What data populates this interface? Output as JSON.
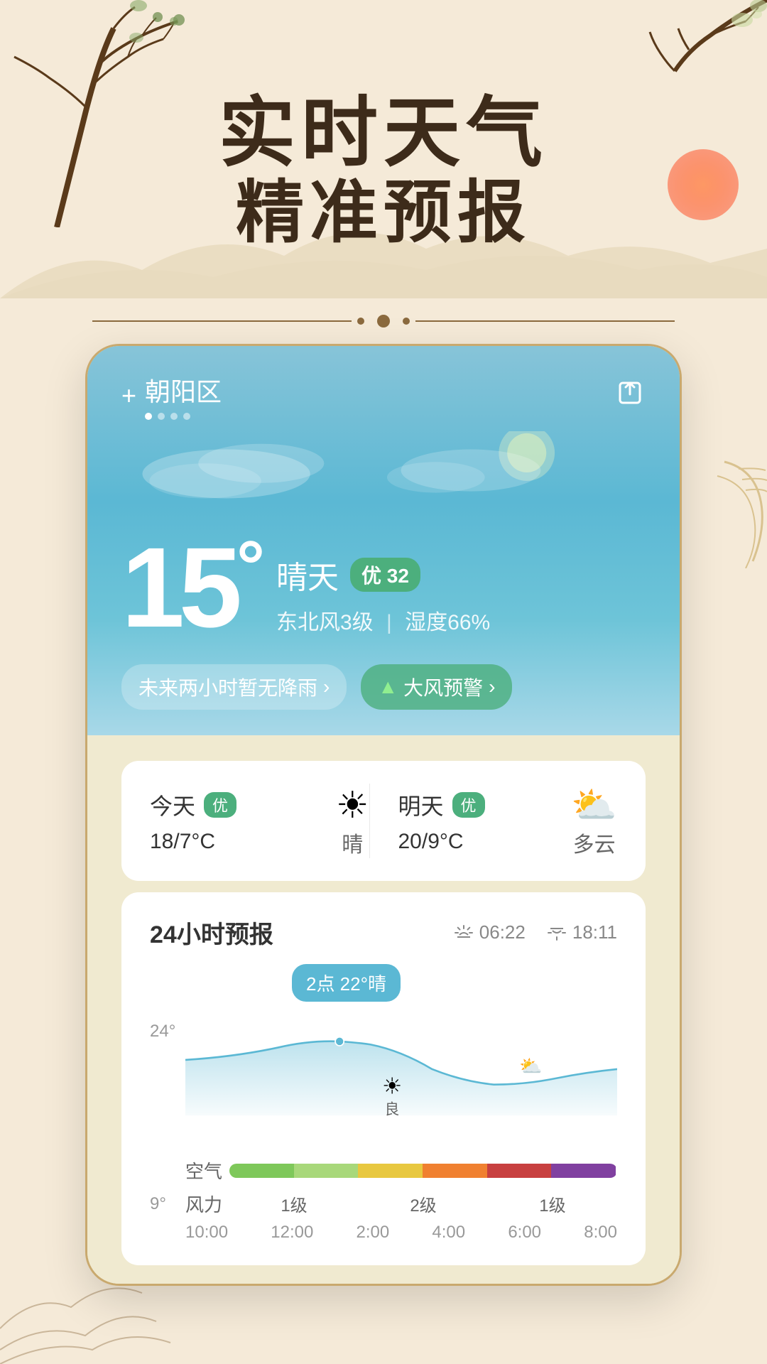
{
  "app": {
    "title1": "实时天气",
    "title2": "精准预报"
  },
  "header": {
    "location": "朝阳区",
    "dots": [
      "active",
      "inactive",
      "inactive",
      "inactive"
    ],
    "plus_label": "+",
    "share_icon": "⬡"
  },
  "current_weather": {
    "temperature": "15",
    "degree_symbol": "°",
    "condition": "晴天",
    "aqi_label": "优",
    "aqi_value": "32",
    "wind_info": "东北风3级",
    "humidity": "湿度66%",
    "separator": "|",
    "alerts": [
      {
        "label": "未来两小时暂无降雨",
        "type": "normal"
      },
      {
        "label": "大风预警",
        "type": "green",
        "icon": "▲"
      }
    ]
  },
  "daily_forecast": [
    {
      "day": "今天",
      "badge": "优",
      "temp": "18/7°C",
      "condition": "晴",
      "icon": "☀"
    },
    {
      "day": "明天",
      "badge": "优",
      "temp": "20/9°C",
      "condition": "多云",
      "icon": "⛅"
    }
  ],
  "hourly_section": {
    "title": "24小时预报",
    "sunrise": "06:22",
    "sunset": "18:11",
    "sunrise_label": "06:22",
    "sunset_label": "18:11",
    "tooltip": "2点 22°晴",
    "high_temp_label": "24°",
    "low_temp_label": "9°",
    "icon1": "☀",
    "icon2": "⛅",
    "icon_label1": "良",
    "air_quality_label": "空气",
    "wind_label": "风力",
    "wind_levels": [
      "1级",
      "2级",
      "1级"
    ],
    "time_labels": [
      "10:00",
      "12:00",
      "2:00",
      "4:00",
      "6:00",
      "8:00"
    ]
  },
  "colors": {
    "sky_blue": "#5bb8d4",
    "aqi_green": "#4caf7d",
    "bg": "#f5ead8",
    "text_dark": "#3d2b1a",
    "card_bg": "#ffffff"
  }
}
